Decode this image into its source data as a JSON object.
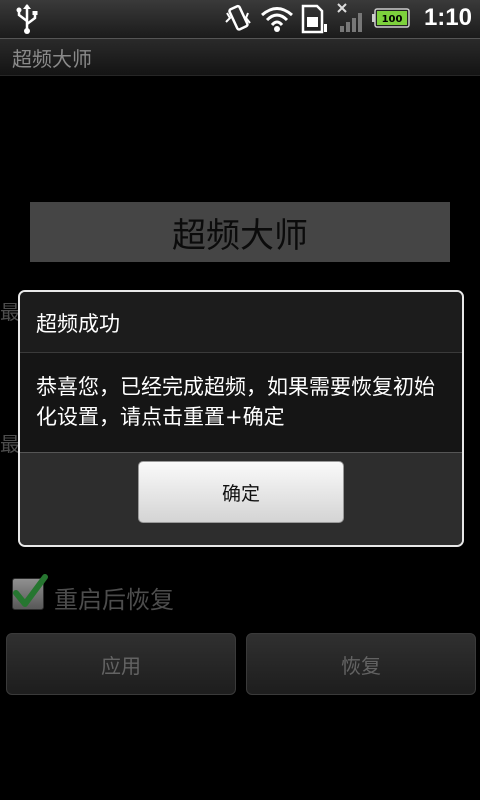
{
  "status_bar": {
    "time": "1:10",
    "battery_level": "100",
    "icons": [
      "usb-icon",
      "vibrate-icon",
      "wifi-icon",
      "sim-icon",
      "signal-icon",
      "battery-icon"
    ]
  },
  "app": {
    "window_title": "超频大师",
    "header": "超频大师",
    "row_label_1": "最",
    "row_label_2": "最",
    "checkbox_label": "重启后恢复",
    "checkbox_checked": true,
    "apply_button": "应用",
    "restore_button": "恢复"
  },
  "dialog": {
    "title": "超频成功",
    "message": "恭喜您，已经完成超频，如果需要恢复初始化设置，请点击重置+确定",
    "ok_button": "确定"
  },
  "colors": {
    "checkmark": "#3bb54a",
    "battery_fill": "#7dd13c",
    "dialog_border": "#e8e8e8"
  }
}
